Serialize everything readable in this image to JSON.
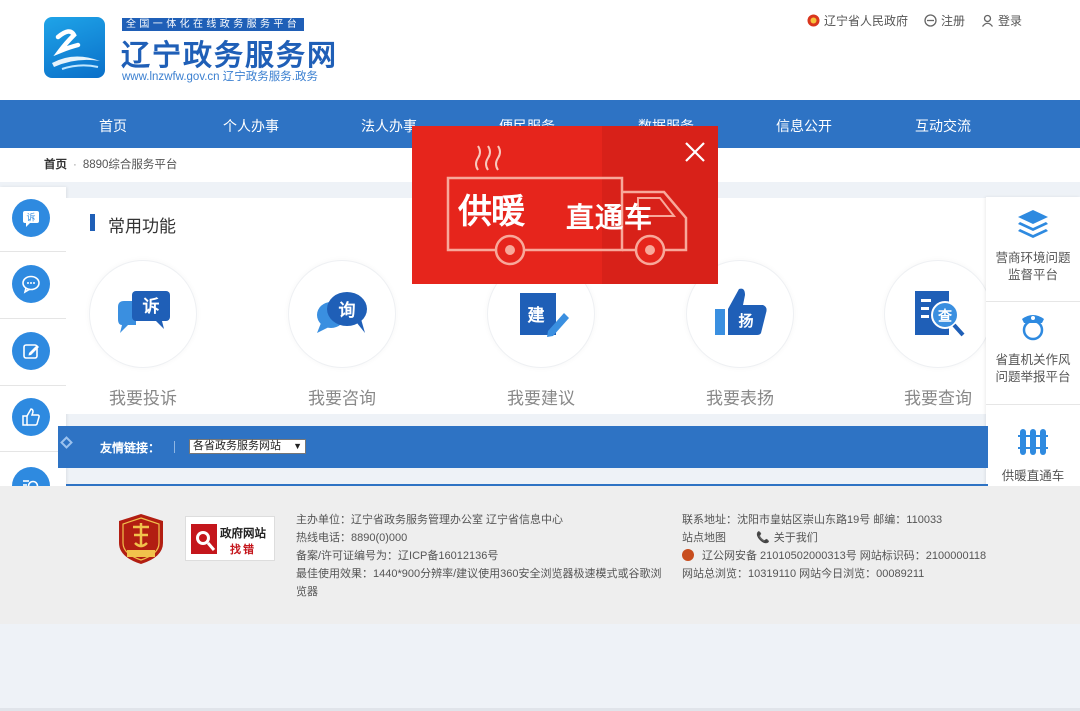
{
  "header": {
    "badge": "全国一体化在线政务服务平台",
    "title": "辽宁政务服务网",
    "url": "www.lnzwfw.gov.cn  辽宁政务服务.政务",
    "top_links": [
      "辽宁省人民政府",
      "注册",
      "登录"
    ]
  },
  "nav": {
    "items": [
      "首页",
      "个人办事",
      "法人办事",
      "便民服务",
      "数据服务",
      "信息公开",
      "互动交流"
    ]
  },
  "breadcrumb": {
    "home": "首页",
    "separator": "·",
    "current": "8890综合服务平台"
  },
  "main": {
    "section_title": "常用功能",
    "functions": [
      {
        "label": "我要投诉",
        "icon_char": "诉",
        "icon": "complaint-icon"
      },
      {
        "label": "我要咨询",
        "icon_char": "询",
        "icon": "consult-icon"
      },
      {
        "label": "我要建议",
        "icon_char": "建",
        "icon": "suggest-icon"
      },
      {
        "label": "我要表扬",
        "icon_char": "扬",
        "icon": "praise-icon"
      },
      {
        "label": "我要查询",
        "icon_char": "查",
        "icon": "query-icon"
      }
    ]
  },
  "left_bar": {
    "icons": [
      "complaint-icon",
      "chat-icon",
      "edit-icon",
      "thumbs-up-icon",
      "search-icon"
    ],
    "first_icon_char": "诉"
  },
  "right_bar": {
    "items": [
      {
        "label_line1": "营商环境问题",
        "label_line2": "监督平台",
        "icon": "layers-icon"
      },
      {
        "label_line1": "省直机关作风",
        "label_line2": "问题举报平台",
        "icon": "officer-icon"
      },
      {
        "label_line1": "供暖直通车",
        "label_line2": "",
        "icon": "radiator-icon"
      }
    ]
  },
  "links": {
    "label": "友情链接：",
    "select_value": "各省政务服务网站"
  },
  "footer": {
    "badge_gov_line1": "政府网站",
    "badge_gov_line2": "找错",
    "col1": [
      "主办单位：辽宁省政务服务管理办公室    辽宁省信息中心",
      "热线电话：8890(0)000",
      "备案/许可证编号为：辽ICP备16012136号",
      "最佳使用效果：1440*900分辨率/建议使用360安全浏览器极速模式或谷歌浏",
      "览器"
    ],
    "address": "联系地址：沈阳市皇姑区崇山东路19号    邮编：110033",
    "sitemap": "站点地图",
    "about": "关于我们",
    "police": "辽公网安备 21010502000313号 网站标识码：2100000118",
    "visits": "网站总浏览：10319110      网站今日浏览：00089211"
  },
  "popup": {
    "text1": "供暖",
    "text2": "直通车"
  },
  "colors": {
    "nav": "#2e73c4",
    "brand": "#1f5fb7",
    "popup": "#e8251c"
  }
}
